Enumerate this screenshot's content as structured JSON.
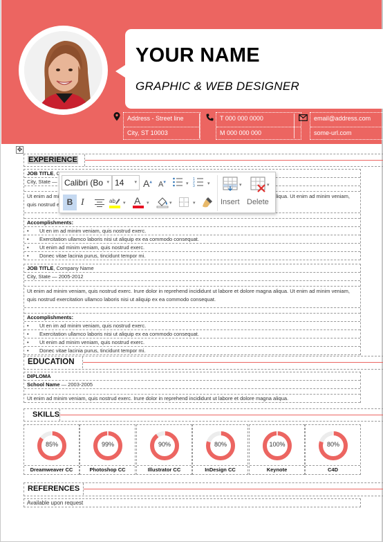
{
  "header": {
    "name": "YOUR NAME",
    "role": "GRAPHIC & WEB DESIGNER",
    "accent_color": "#EC6561",
    "contacts": [
      {
        "icon": "map-pin-icon",
        "lines": [
          "Address  - Street line",
          "City, ST 10003"
        ]
      },
      {
        "icon": "phone-icon",
        "lines": [
          "T 000 000 0000",
          "M 000 000 000"
        ]
      },
      {
        "icon": "envelope-icon",
        "lines": [
          "email@address.com",
          "some-url.com"
        ]
      }
    ]
  },
  "toolbar": {
    "font_name": "Calibri (Bo",
    "font_size": "14",
    "bold": "B",
    "italic": "I",
    "insert_label": "Insert",
    "delete_label": "Delete"
  },
  "sections": {
    "experience": "EXPERIENCE",
    "education": "EDUCATION",
    "skills": "SKILLS",
    "references": "REFERENCES"
  },
  "experience": [
    {
      "title": "JOB TITLE",
      "company": ", Company Name",
      "location": "City, State — 2005-2012",
      "description": "Ut enim ad minim veniam, quis nostrud exerc. Irure dolor in reprehend incididunt ut labore et dolore magna aliqua. Ut enim ad minim veniam, quis nostrud exercitation ullamco laboris nisi ut aliquip ex ea commodo consequat.",
      "accomplishments_label": "Accomplishments:",
      "bullets": [
        "Ut en im ad minim veniam, quis nostrud exerc.",
        "Exercitation ullamco laboris nisi ut aliquip ex ea commodo consequat.",
        "Ut enim ad minim veniam, quis nostrud exerc.",
        "Donec vitae lacinia purus, tincidunt tempor mi."
      ]
    },
    {
      "title": "JOB TITLE",
      "company": ", Company Name",
      "location": "City, State — 2005-2012",
      "description": "Ut enim ad minim veniam, quis nostrud exerc. Irure dolor in reprehend incididunt ut labore et dolore magna aliqua. Ut enim ad minim veniam, quis nostrud exercitation ullamco laboris nisi ut aliquip ex ea commodo consequat.",
      "accomplishments_label": "Accomplishments:",
      "bullets": [
        "Ut en im ad minim veniam, quis nostrud exerc.",
        "Exercitation ullamco laboris nisi ut aliquip ex ea commodo consequat.",
        "Ut enim ad minim veniam, quis nostrud exerc.",
        "Donec vitae lacinia purus, tincidunt tempor mi."
      ]
    }
  ],
  "education": {
    "degree": "DIPLOMA",
    "school": "School Name",
    "years": " — 2003-2005",
    "description": "Ut enim ad minim veniam, quis nostrud exerc. Irure dolor in reprehend incididunt ut labore et dolore magna aliqua."
  },
  "skills": [
    {
      "name": "Dreamweaver CC",
      "percent": 85,
      "label": "85%"
    },
    {
      "name": "Photoshop CC",
      "percent": 99,
      "label": "99%"
    },
    {
      "name": "Illustrator CC",
      "percent": 90,
      "label": "90%"
    },
    {
      "name": "InDesign CC",
      "percent": 80,
      "label": "80%"
    },
    {
      "name": "Keynote",
      "percent": 100,
      "label": "100%"
    },
    {
      "name": "C4D",
      "percent": 80,
      "label": "80%"
    }
  ],
  "references": {
    "text": "Available upon request"
  }
}
